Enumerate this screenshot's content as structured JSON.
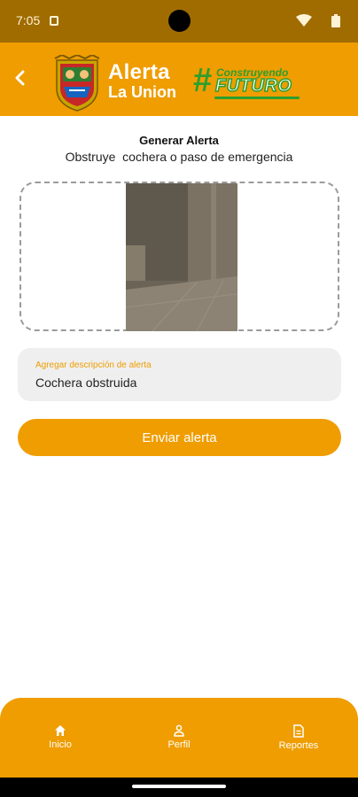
{
  "status_bar": {
    "time": "7:05"
  },
  "header": {
    "app_title_line1": "Alerta",
    "app_title_line2": "La Union",
    "slogan_hash": "#",
    "slogan_top": "Construyendo",
    "slogan_main": "FUTURO"
  },
  "form": {
    "title": "Generar Alerta",
    "subtitle": "Obstruye  cochera o paso de emergencia",
    "description_label": "Agregar descripción de alerta",
    "description_value": "Cochera obstruida",
    "submit_label": "Enviar alerta"
  },
  "bottom_nav": {
    "items": [
      {
        "label": "Inicio",
        "icon": "home-icon"
      },
      {
        "label": "Perfil",
        "icon": "person-icon"
      },
      {
        "label": "Reportes",
        "icon": "document-icon"
      }
    ]
  },
  "colors": {
    "primary": "#ef9d00",
    "status_bar": "#a06c00",
    "brand_green": "#2e9e2e",
    "field_background": "#efefef"
  }
}
